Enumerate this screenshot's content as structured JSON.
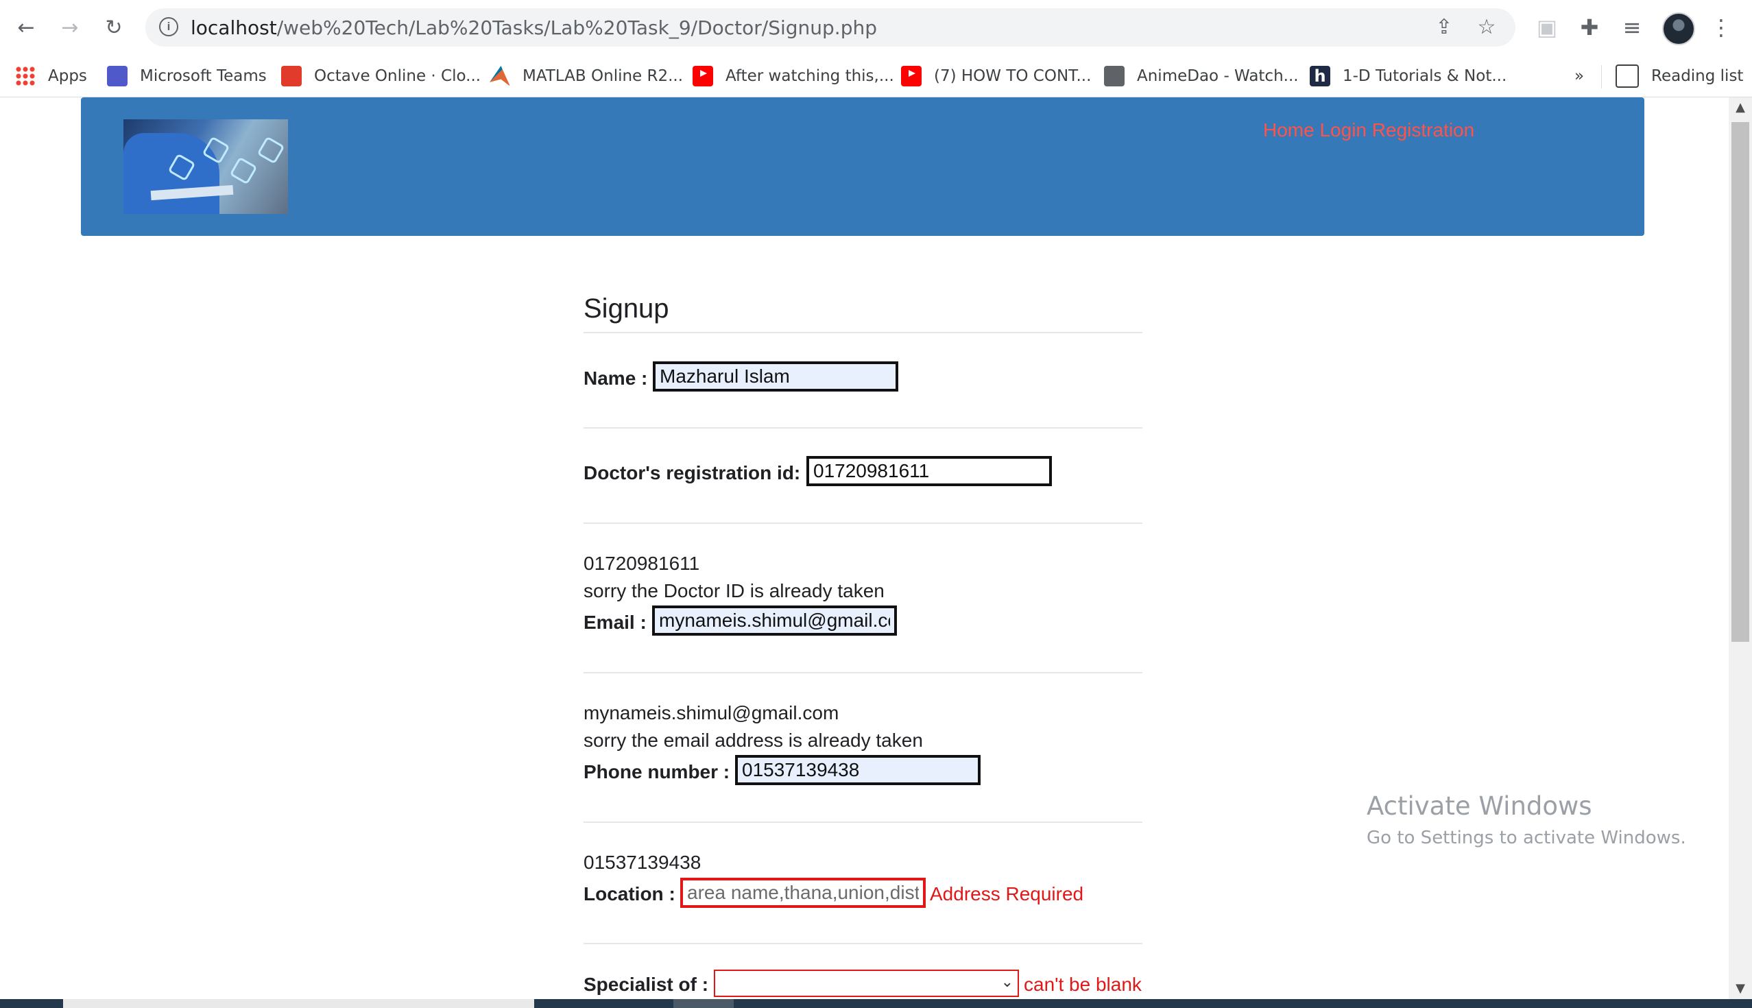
{
  "browser": {
    "url_host": "localhost",
    "url_path": "/web%20Tech/Lab%20Tasks/Lab%20Task_9/Doctor/Signup.php",
    "bookmarks": [
      {
        "label": "Apps",
        "icon": "apps-grid-icon"
      },
      {
        "label": "Microsoft Teams",
        "icon": "teams-icon"
      },
      {
        "label": "Octave Online · Clo...",
        "icon": "octave-icon"
      },
      {
        "label": "MATLAB Online R2...",
        "icon": "matlab-icon"
      },
      {
        "label": "After watching this,...",
        "icon": "youtube-icon"
      },
      {
        "label": "(7) HOW TO CONT...",
        "icon": "youtube-icon"
      },
      {
        "label": "AnimeDao - Watch...",
        "icon": "globe-icon"
      },
      {
        "label": "1-D Tutorials & Not...",
        "icon": "h-icon"
      }
    ],
    "overflow_label": "»",
    "reading_list_label": "Reading list"
  },
  "header": {
    "nav": {
      "home": "Home",
      "login": "Login",
      "registration": "Registration"
    },
    "colors": {
      "bar": "#3579b8",
      "links": "#ff5349"
    }
  },
  "form": {
    "title": "Signup",
    "name": {
      "label": "Name :",
      "value": "Mazharul Islam"
    },
    "reg_id": {
      "label": "Doctor's registration id:",
      "value": "01720981611",
      "echo": "01720981611",
      "message": "sorry the Doctor ID is already taken"
    },
    "email": {
      "label": "Email :",
      "value": "mynameis.shimul@gmail.com",
      "echo": "mynameis.shimul@gmail.com",
      "message": "sorry the email address is already taken"
    },
    "phone": {
      "label": "Phone number :",
      "value": "01537139438",
      "echo": "01537139438"
    },
    "location": {
      "label": "Location :",
      "placeholder": "area name,thana,union,district",
      "error": "Address Required"
    },
    "specialist": {
      "label": "Specialist of :",
      "selected": "",
      "error": "can't be blank"
    },
    "colors": {
      "error": "#e01818"
    }
  },
  "watermark": {
    "line1": "Activate Windows",
    "line2": "Go to Settings to activate Windows."
  }
}
